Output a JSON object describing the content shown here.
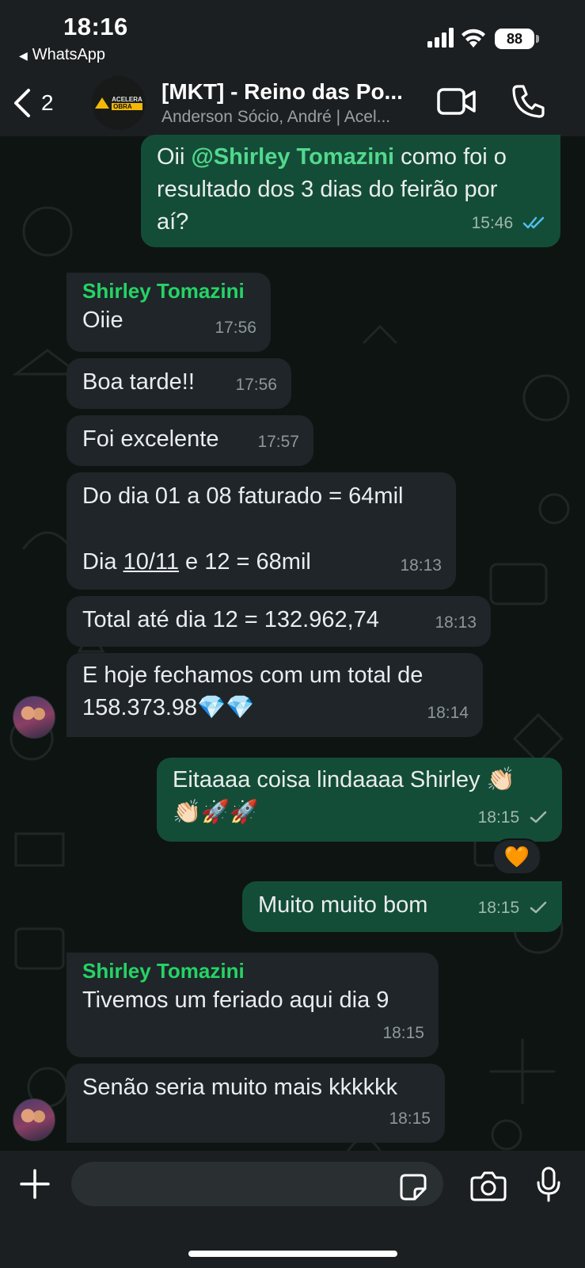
{
  "status_bar": {
    "time": "18:16",
    "back_app": "WhatsApp",
    "battery": "88"
  },
  "header": {
    "back_count": "2",
    "group_name": "[MKT] - Reino das Po...",
    "members": "Anderson Sócio, André | Acel...",
    "logo_top": "ACELERA",
    "logo_bottom": "OBRA"
  },
  "messages": [
    {
      "dir": "out",
      "prefix": "Oii ",
      "mention": "@Shirley Tomazini",
      "text_l1_rest": " como foi o",
      "text_l2": "resultado dos 3 dias do feirão por",
      "text_l3": "aí?",
      "time": "15:46",
      "status": "read"
    },
    {
      "dir": "in",
      "sender": "Shirley Tomazini",
      "text": "Oiie",
      "time": "17:56"
    },
    {
      "dir": "in",
      "text": "Boa tarde!!",
      "time": "17:56"
    },
    {
      "dir": "in",
      "text": "Foi excelente",
      "time": "17:57"
    },
    {
      "dir": "in",
      "text_l1": "Do dia 01 a 08 faturado = 64mil",
      "text_l2_a": "Dia ",
      "text_l2_link": "10/11",
      "text_l2_b": " e 12 = 68mil",
      "time": "18:13"
    },
    {
      "dir": "in",
      "text": "Total até dia 12 = 132.962,74",
      "time": "18:13"
    },
    {
      "dir": "in",
      "text_l1": "E hoje fechamos com um total de",
      "text_l2": "158.373.98💎💎",
      "time": "18:14"
    },
    {
      "dir": "out",
      "text_l1": "Eitaaaa coisa lindaaaa Shirley 👏🏻",
      "text_l2": "👏🏻🚀🚀",
      "time": "18:15",
      "status": "delivered",
      "reaction": "🧡"
    },
    {
      "dir": "out",
      "text": "Muito muito bom",
      "time": "18:15",
      "status": "delivered"
    },
    {
      "dir": "in",
      "sender": "Shirley Tomazini",
      "text": "Tivemos um feriado aqui dia 9",
      "time": "18:15"
    },
    {
      "dir": "in",
      "text": "Senão seria muito mais kkkkkk",
      "time": "18:15"
    }
  ],
  "composer": {
    "placeholder": ""
  },
  "colors": {
    "accent_green": "#25d366",
    "outgoing_bubble": "#144d37",
    "incoming_bubble": "#1f2528",
    "read_tick": "#53bdeb"
  }
}
